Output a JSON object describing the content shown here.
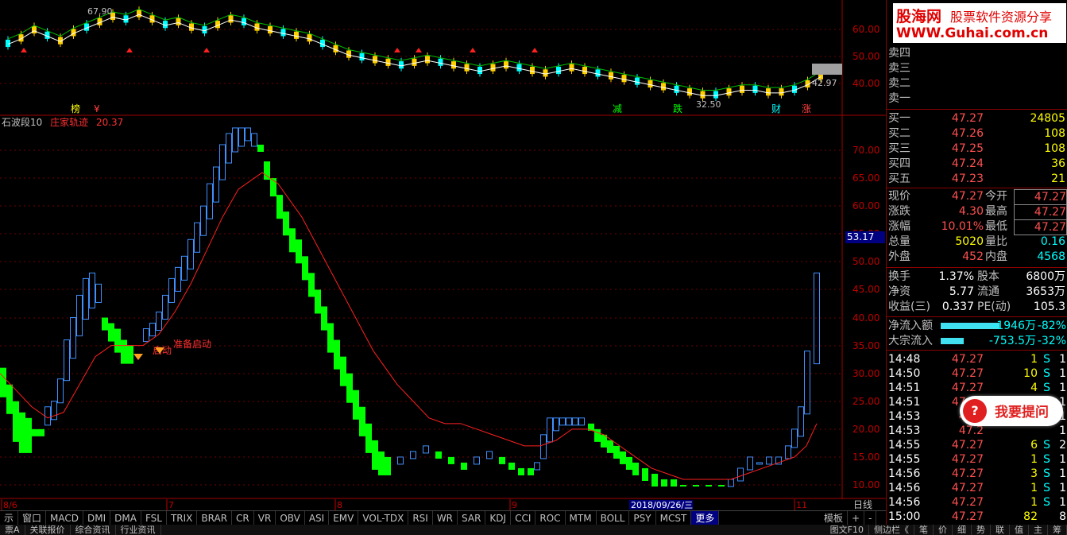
{
  "top_chart": {
    "ma_legend_prefix": "",
    "high_label": "67.90",
    "low_label": "32.50",
    "current_label": "42.97",
    "markers": [
      "榜",
      "¥",
      "减",
      "跌",
      "财",
      "涨"
    ],
    "y_ticks": [
      "60.00",
      "50.00",
      "40.00"
    ]
  },
  "indicator": {
    "name": "石波段10",
    "line_name": "庄家轨迹",
    "line_value": "20.37",
    "annotation1": "准备启动",
    "annotation2": "启动",
    "y_ticks": [
      "70.00",
      "65.00",
      "60.00",
      "55.00",
      "50.00",
      "45.00",
      "40.00",
      "35.00",
      "30.00",
      "25.00",
      "20.00",
      "15.00",
      "10.00"
    ],
    "price_box": "53.17"
  },
  "x_axis": {
    "labels": [
      "8/6",
      "7",
      "8",
      "9",
      "11"
    ],
    "date_box": "2018/09/26/三",
    "right_label": "日线"
  },
  "tabs": [
    "示",
    "窗口",
    "MACD",
    "DMI",
    "DMA",
    "FSL",
    "TRIX",
    "BRAR",
    "CR",
    "VR",
    "OBV",
    "ASI",
    "EMV",
    "VOL-TDX",
    "RSI",
    "WR",
    "SAR",
    "KDJ",
    "CCI",
    "ROC",
    "MTM",
    "BOLL",
    "PSY",
    "MCST",
    "更多"
  ],
  "tab_right": [
    "模板",
    "+",
    "-"
  ],
  "bottom_bar": [
    "票A",
    "关联报价",
    "综合资讯",
    "行业资讯"
  ],
  "bottom_bar_right": [
    "图文F10",
    "侧边栏《",
    "笔",
    "价",
    "细",
    "势",
    "联",
    "值",
    "主",
    "筹"
  ],
  "logo": {
    "line1": "股海网",
    "line1b": "股票软件资源分享",
    "line2": "WWW.Guhai.com.cn"
  },
  "order_book": {
    "sell": [
      {
        "label": "卖四"
      },
      {
        "label": "卖三"
      },
      {
        "label": "卖二"
      },
      {
        "label": "卖一"
      }
    ],
    "buy": [
      {
        "label": "买一",
        "price": "47.27",
        "vol": "24805"
      },
      {
        "label": "买二",
        "price": "47.26",
        "vol": "108"
      },
      {
        "label": "买三",
        "price": "47.25",
        "vol": "108"
      },
      {
        "label": "买四",
        "price": "47.24",
        "vol": "36"
      },
      {
        "label": "买五",
        "price": "47.23",
        "vol": "21"
      }
    ]
  },
  "quote": [
    {
      "l1": "现价",
      "v1": "47.27",
      "l2": "今开",
      "v2": "47.27"
    },
    {
      "l1": "涨跌",
      "v1": "4.30",
      "l2": "最高",
      "v2": "47.27"
    },
    {
      "l1": "涨幅",
      "v1": "10.01%",
      "l2": "最低",
      "v2": "47.27"
    },
    {
      "l1": "总量",
      "v1": "5020",
      "l2": "量比",
      "v2": "0.16"
    },
    {
      "l1": "外盘",
      "v1": "452",
      "l2": "内盘",
      "v2": "4568"
    }
  ],
  "stats": [
    {
      "l1": "换手",
      "v1": "1.37%",
      "l2": "股本",
      "v2": "6800万"
    },
    {
      "l1": "净资",
      "v1": "5.77",
      "l2": "流通",
      "v2": "3653万"
    },
    {
      "l1": "收益(三)",
      "v1": "0.337",
      "l2": "PE(动)",
      "v2": "105.3"
    }
  ],
  "flows": [
    {
      "label": "净流入额",
      "value": "-1946万",
      "pct": "-82%",
      "bar": 0.82
    },
    {
      "label": "大宗流入",
      "value": "-753.5万",
      "pct": "-32%",
      "bar": 0.32
    }
  ],
  "ticks": [
    {
      "time": "14:48",
      "price": "47.27",
      "vol": "1",
      "side": "S",
      "n": "1"
    },
    {
      "time": "14:50",
      "price": "47.27",
      "vol": "10",
      "side": "S",
      "n": "1"
    },
    {
      "time": "14:51",
      "price": "47.27",
      "vol": "4",
      "side": "S",
      "n": "1"
    },
    {
      "time": "14:51",
      "price": "47.27",
      "vol": "25",
      "side": "S",
      "n": "1"
    },
    {
      "time": "14:53",
      "price": "47.2",
      "vol": "",
      "side": "",
      "n": "1"
    },
    {
      "time": "14:53",
      "price": "47.2",
      "vol": "",
      "side": "",
      "n": "1"
    },
    {
      "time": "14:55",
      "price": "47.27",
      "vol": "6",
      "side": "S",
      "n": "2"
    },
    {
      "time": "14:55",
      "price": "47.27",
      "vol": "1",
      "side": "S",
      "n": "1"
    },
    {
      "time": "14:56",
      "price": "47.27",
      "vol": "3",
      "side": "S",
      "n": "1"
    },
    {
      "time": "14:56",
      "price": "47.27",
      "vol": "1",
      "side": "S",
      "n": "1"
    },
    {
      "time": "14:56",
      "price": "47.27",
      "vol": "1",
      "side": "S",
      "n": "1"
    },
    {
      "time": "15:00",
      "price": "47.27",
      "vol": "82",
      "side": "",
      "n": "8"
    }
  ],
  "bubble": {
    "icon": "?",
    "text": "我要提问"
  }
}
